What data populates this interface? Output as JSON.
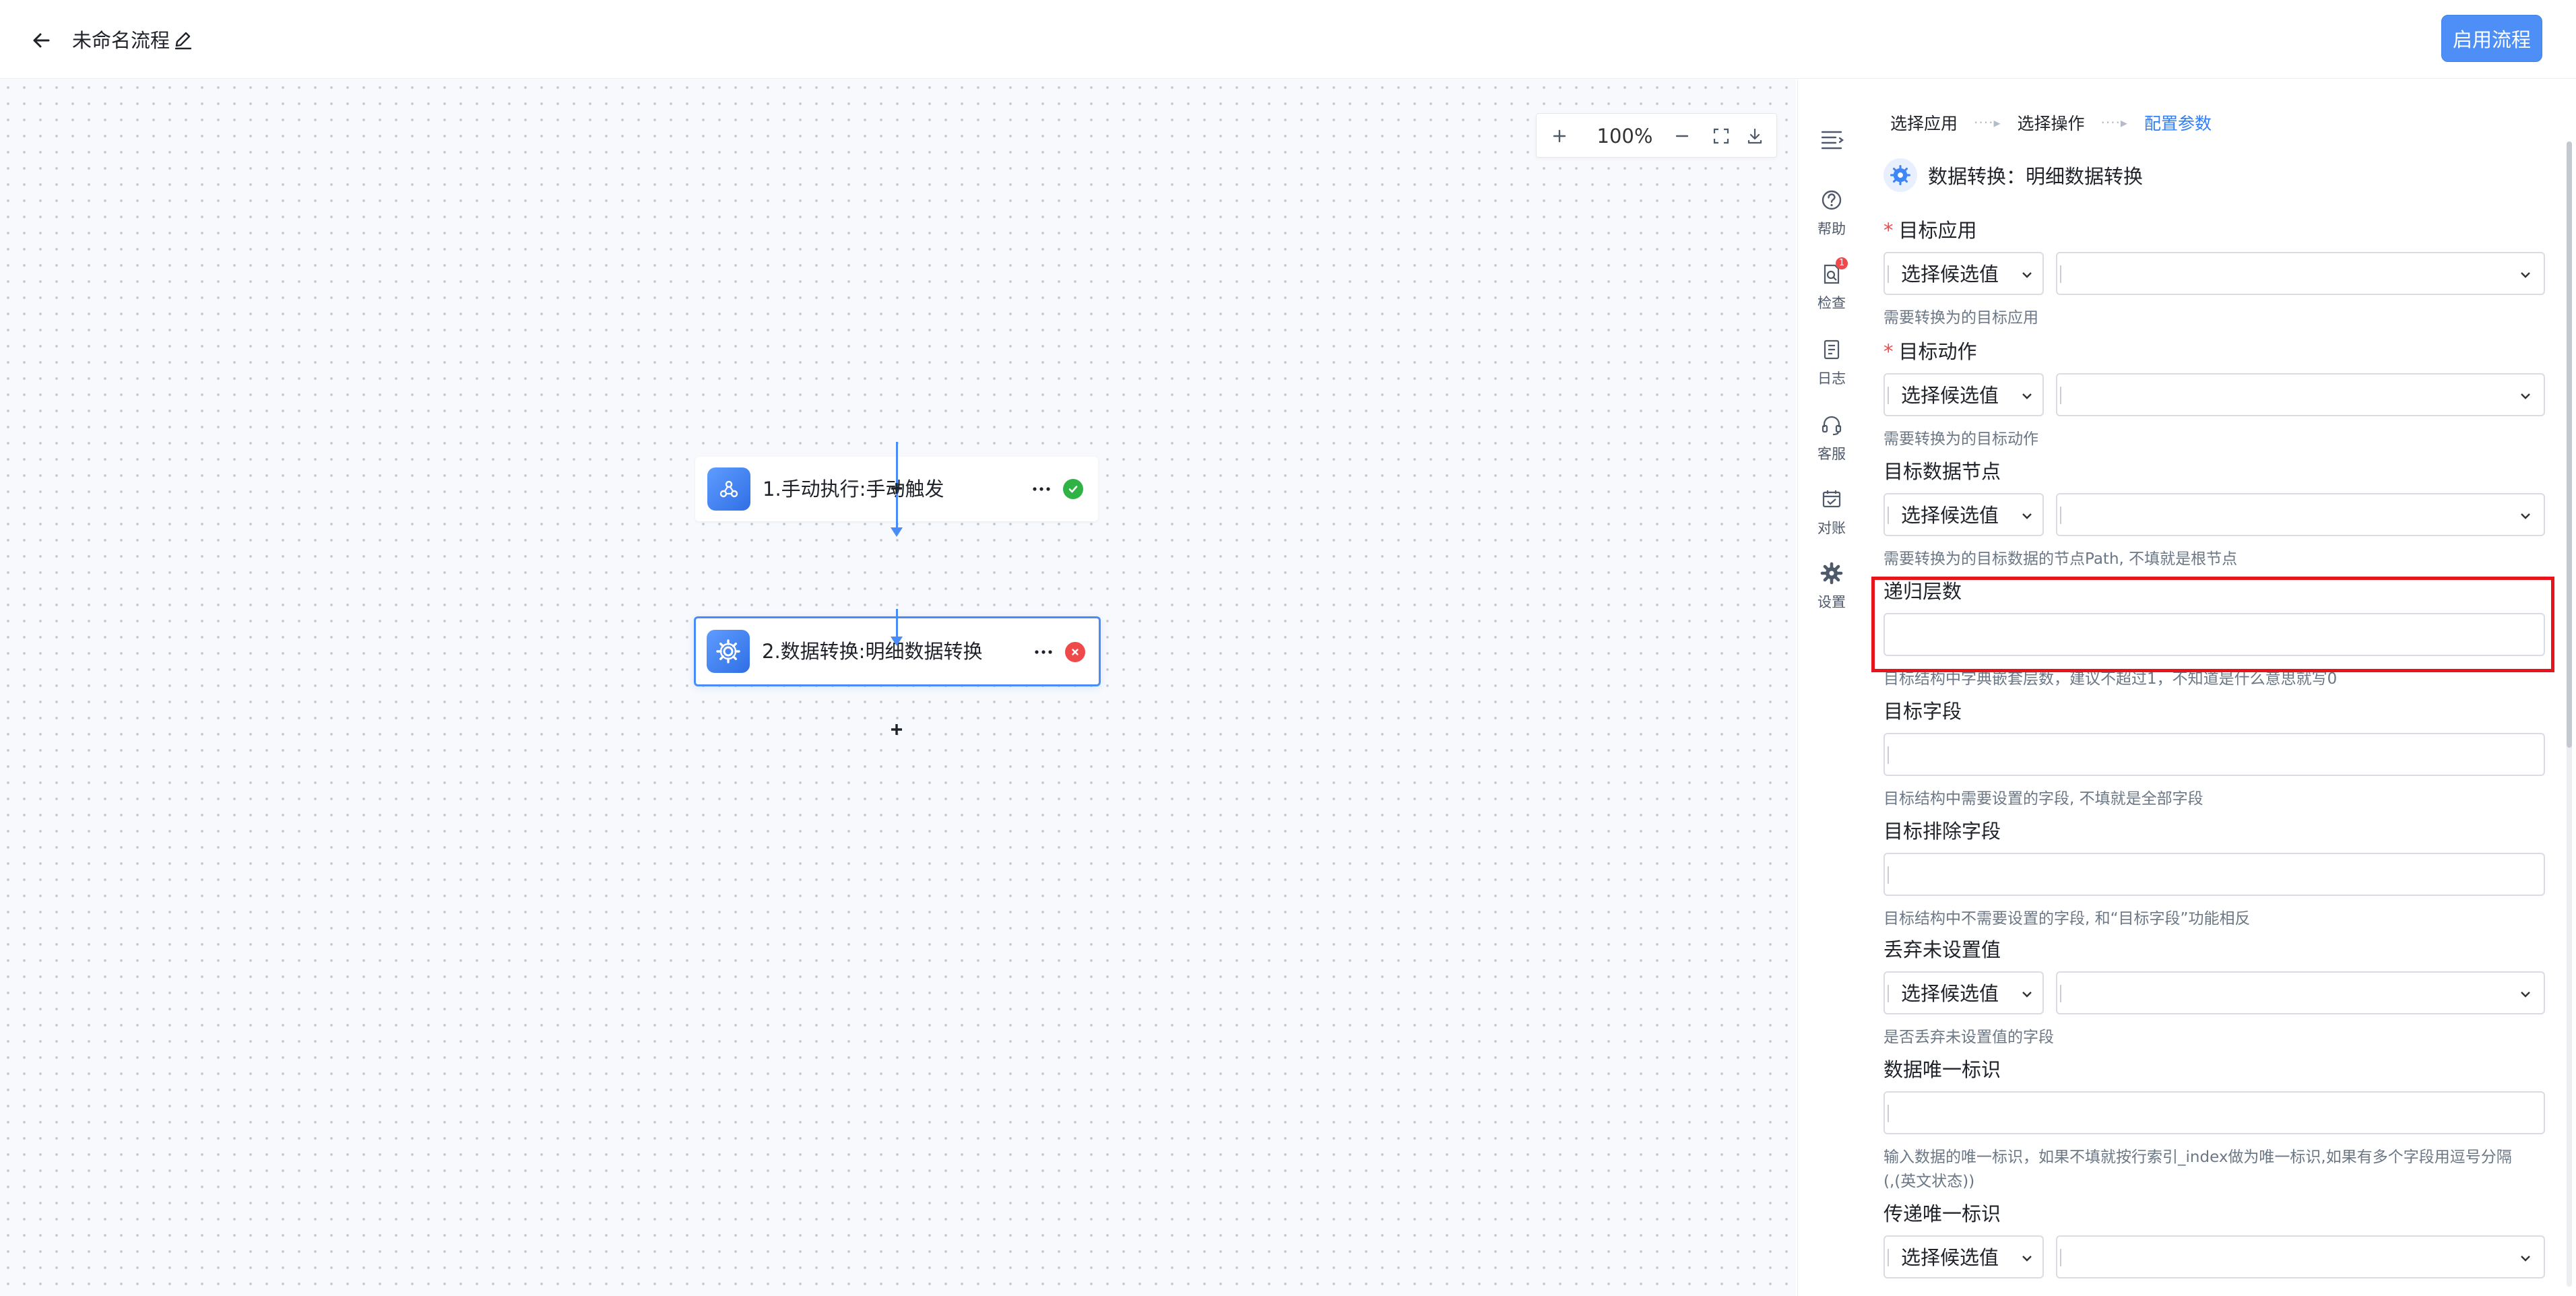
{
  "header": {
    "title": "未命名流程",
    "enable_label": "启用流程"
  },
  "canvas": {
    "zoom_level": "100%",
    "nodes": [
      {
        "label": "1.手动执行:手动触发",
        "status": "success",
        "icon": "trigger-icon"
      },
      {
        "label": "2.数据转换:明细数据转换",
        "status": "error",
        "icon": "gear-icon"
      }
    ]
  },
  "tool_rail": {
    "items": [
      {
        "label": "",
        "icon": "menu-collapse-icon"
      },
      {
        "label": "帮助",
        "icon": "help-icon"
      },
      {
        "label": "检查",
        "icon": "check-icon",
        "badge": "1"
      },
      {
        "label": "日志",
        "icon": "log-icon"
      },
      {
        "label": "客服",
        "icon": "headset-icon"
      },
      {
        "label": "对账",
        "icon": "reconcile-icon"
      },
      {
        "label": "设置",
        "icon": "settings-icon"
      }
    ]
  },
  "panel": {
    "steps": [
      "选择应用",
      "选择操作",
      "配置参数"
    ],
    "active_step": 2,
    "title": "数据转换：明细数据转换",
    "select_placeholder": "选择候选值",
    "fields": [
      {
        "label": "目标应用",
        "required": true,
        "help": "需要转换为的目标应用"
      },
      {
        "label": "目标动作",
        "required": true,
        "help": "需要转换为的目标动作"
      },
      {
        "label": "目标数据节点",
        "help": "需要转换为的目标数据的节点Path, 不填就是根节点"
      },
      {
        "label": "递归层数",
        "help": "目标结构中字典嵌套层数，建议不超过1，不知道是什么意思就写0"
      },
      {
        "label": "目标字段",
        "help": "目标结构中需要设置的字段, 不填就是全部字段"
      },
      {
        "label": "目标排除字段",
        "help": "目标结构中不需要设置的字段, 和“目标字段”功能相反"
      },
      {
        "label": "丢弃未设置值",
        "help": "是否丢弃未设置值的字段"
      },
      {
        "label": "数据唯一标识",
        "help": "输入数据的唯一标识，如果不填就按行索引_index做为唯一标识,如果有多个字段用逗号分隔",
        "help2": "(,(英文状态))"
      },
      {
        "label": "传递唯一标识"
      }
    ]
  }
}
